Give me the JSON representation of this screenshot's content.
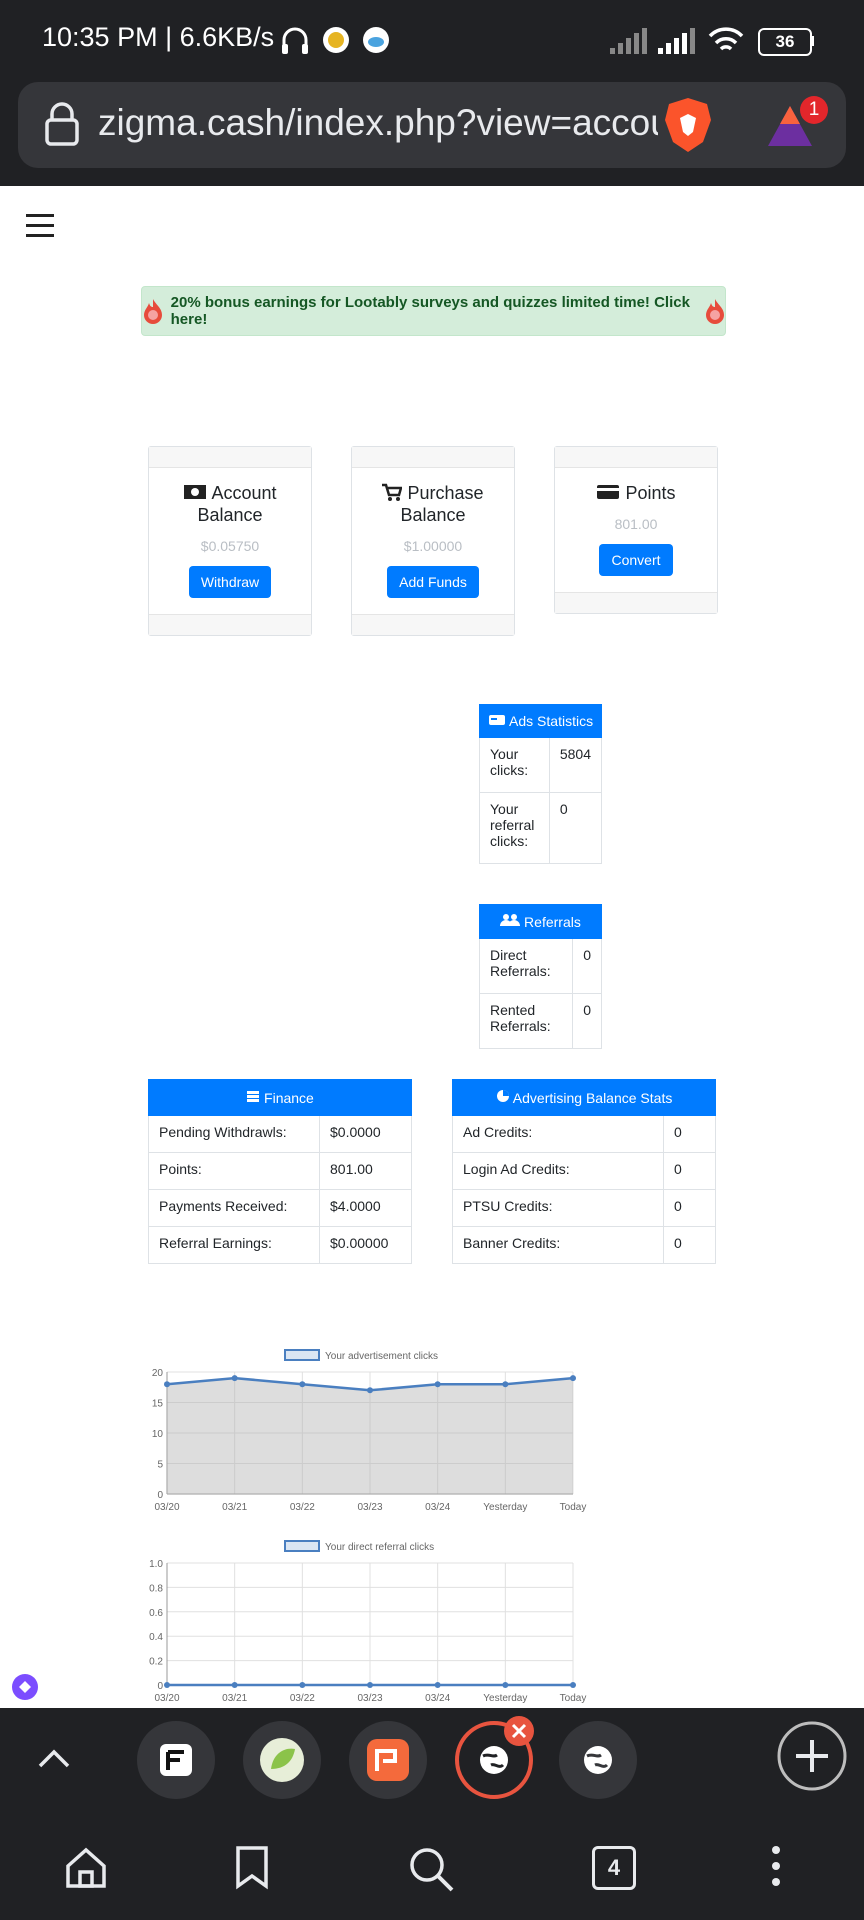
{
  "status_bar": {
    "time_speed": "10:35 PM | 6.6KB/s",
    "battery": "36"
  },
  "browser": {
    "url": "zigma.cash/index.php?view=accou",
    "notification_count": "1"
  },
  "promo_banner": "20% bonus earnings for Lootably surveys and quizzes limited time! Click here!",
  "cards": {
    "account": {
      "title": "Account Balance",
      "value": "$0.05750",
      "button": "Withdraw"
    },
    "purchase": {
      "title": "Purchase Balance",
      "value": "$1.00000",
      "button": "Add Funds"
    },
    "points": {
      "title": "Points",
      "value": "801.00",
      "button": "Convert"
    }
  },
  "ads_stats": {
    "title": "Ads Statistics",
    "rows": [
      {
        "label": "Your clicks:",
        "value": "5804"
      },
      {
        "label": "Your referral clicks:",
        "value": "0"
      }
    ]
  },
  "referrals": {
    "title": "Referrals",
    "rows": [
      {
        "label": "Direct Referrals:",
        "value": "0"
      },
      {
        "label": "Rented Referrals:",
        "value": "0"
      }
    ]
  },
  "finance": {
    "title": "Finance",
    "rows": [
      {
        "label": "Pending Withdrawls:",
        "value": "$0.0000"
      },
      {
        "label": "Points:",
        "value": "801.00"
      },
      {
        "label": "Payments Received:",
        "value": "$4.0000"
      },
      {
        "label": "Referral Earnings:",
        "value": "$0.00000"
      }
    ]
  },
  "adv_balance": {
    "title": "Advertising Balance Stats",
    "rows": [
      {
        "label": "Ad Credits:",
        "value": "0"
      },
      {
        "label": "Login Ad Credits:",
        "value": "0"
      },
      {
        "label": "PTSU Credits:",
        "value": "0"
      },
      {
        "label": "Banner Credits:",
        "value": "0"
      }
    ]
  },
  "colors": {
    "primary": "#007bff",
    "line": "#4a7fc0"
  },
  "chart_data": [
    {
      "type": "area",
      "x": [
        "03/20",
        "03/21",
        "03/22",
        "03/23",
        "03/24",
        "Yesterday",
        "Today"
      ],
      "series": [
        {
          "name": "Your advertisement clicks",
          "values": [
            18,
            19,
            18,
            17,
            18,
            18,
            19
          ]
        }
      ],
      "ylim": [
        0,
        20
      ],
      "yticks": [
        "0",
        "5",
        "10",
        "15",
        "20"
      ],
      "grid": true,
      "legend": "top"
    },
    {
      "type": "line",
      "x": [
        "03/20",
        "03/21",
        "03/22",
        "03/23",
        "03/24",
        "Yesterday",
        "Today"
      ],
      "series": [
        {
          "name": "Your direct referral clicks",
          "values": [
            0,
            0,
            0,
            0,
            0,
            0,
            0
          ]
        }
      ],
      "ylim": [
        0,
        1
      ],
      "yticks": [
        "0",
        "0.2",
        "0.4",
        "0.6",
        "0.8",
        "1.0"
      ],
      "grid": true,
      "legend": "top"
    }
  ],
  "bottom_nav": {
    "tab_count": "4"
  }
}
